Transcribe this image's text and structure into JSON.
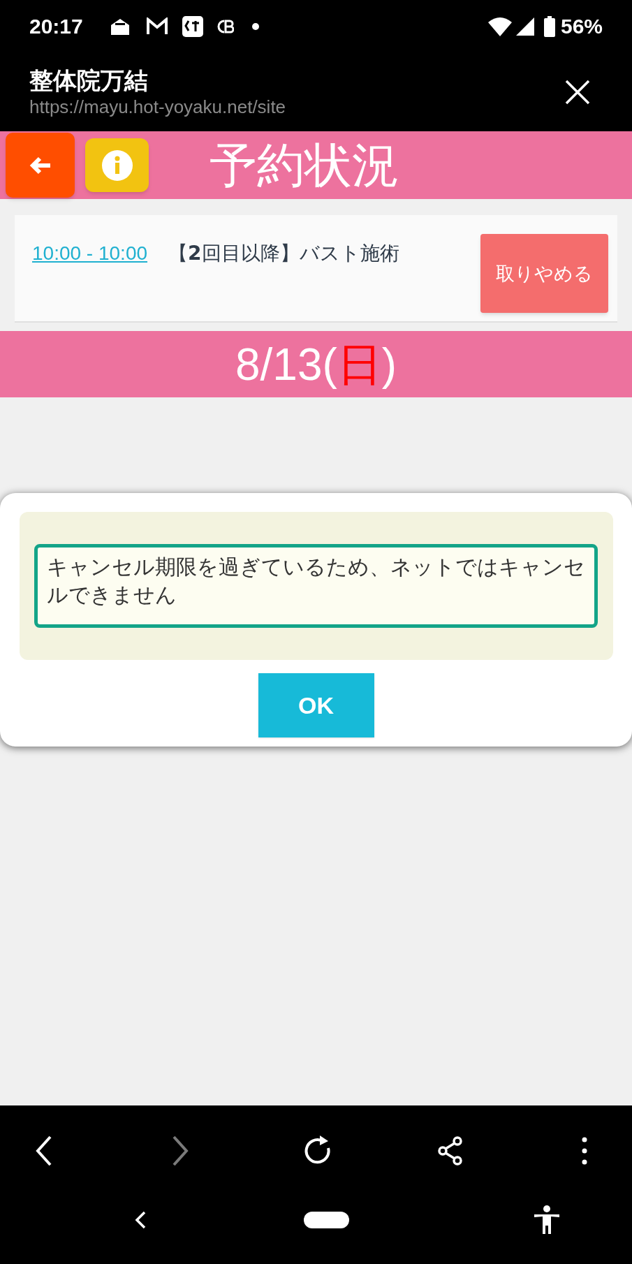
{
  "status_bar": {
    "time": "20:17",
    "battery": "56%"
  },
  "browser": {
    "title": "整体院万結",
    "url": "https://mayu.hot-yoyaku.net/site"
  },
  "header": {
    "title": "予約状況"
  },
  "reservation": {
    "time": "10:00 - 10:00",
    "name": "【**2**回目以降】バスト施術",
    "cancel_label": "取りやめる"
  },
  "date_bar": {
    "date": "8/13(",
    "weekday": "日",
    "close": ")",
    "sunday": true
  },
  "dialog": {
    "message": "キャンセル期限を過ぎているため、ネットではキャンセルできません",
    "ok_label": "OK"
  },
  "browser_toolbar": [
    {
      "kind": "back",
      "disabled": false
    },
    {
      "kind": "forward",
      "disabled": true
    },
    {
      "kind": "reload",
      "disabled": false
    },
    {
      "kind": "share",
      "disabled": false
    },
    {
      "kind": "more",
      "disabled": false
    }
  ]
}
